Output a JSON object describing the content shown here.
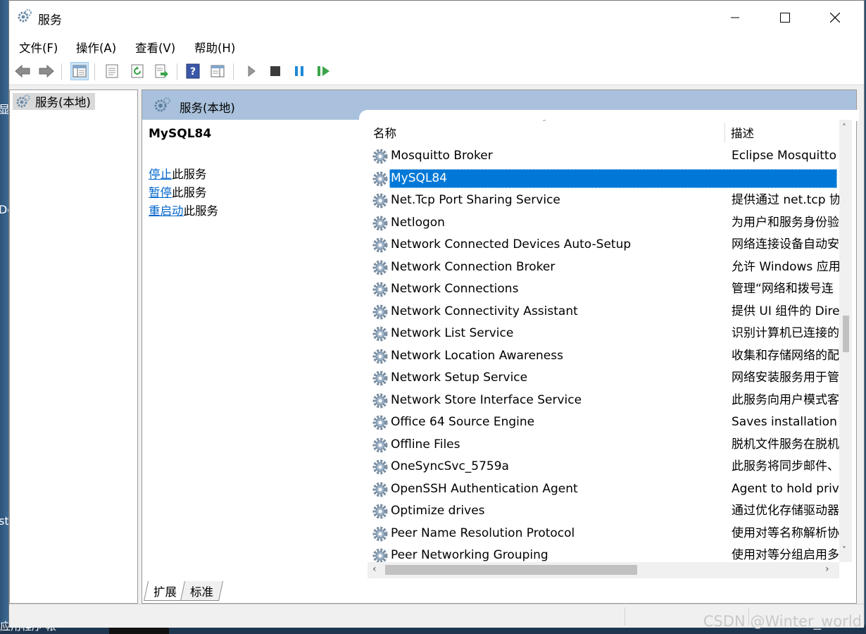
{
  "window": {
    "title": "服务"
  },
  "menu": [
    "文件(F)",
    "操作(A)",
    "查看(V)",
    "帮助(H)"
  ],
  "toolbar_icons": [
    "back-arrow-icon",
    "forward-arrow-icon",
    "show-hide-console-tree-icon",
    "properties-icon",
    "refresh-icon",
    "export-list-icon",
    "help-icon",
    "action-pane-icon",
    "start-service-icon",
    "stop-service-icon",
    "pause-service-icon",
    "restart-service-icon"
  ],
  "tree": {
    "root_label": "服务(本地)"
  },
  "header": {
    "title": "服务(本地)"
  },
  "extended": {
    "service_name": "MySQL84",
    "actions": [
      {
        "link": "停止",
        "suffix": "此服务"
      },
      {
        "link": "暂停",
        "suffix": "此服务"
      },
      {
        "link": "重启动",
        "suffix": "此服务"
      }
    ]
  },
  "columns": {
    "name": "名称",
    "description": "描述"
  },
  "services": [
    {
      "name": "Mosquitto Broker",
      "description": "Eclipse Mosquitto M"
    },
    {
      "name": "MySQL84",
      "description": "",
      "selected": true
    },
    {
      "name": "Net.Tcp Port Sharing Service",
      "description": "提供通过 net.tcp 协"
    },
    {
      "name": "Netlogon",
      "description": "为用户和服务身份验"
    },
    {
      "name": "Network Connected Devices Auto-Setup",
      "description": "网络连接设备自动安"
    },
    {
      "name": "Network Connection Broker",
      "description": "允许 Windows 应用"
    },
    {
      "name": "Network Connections",
      "description": "管理“网络和拨号连"
    },
    {
      "name": "Network Connectivity Assistant",
      "description": "提供 UI 组件的 Dire"
    },
    {
      "name": "Network List Service",
      "description": "识别计算机已连接的"
    },
    {
      "name": "Network Location Awareness",
      "description": "收集和存储网络的配"
    },
    {
      "name": "Network Setup Service",
      "description": "网络安装服务用于管"
    },
    {
      "name": "Network Store Interface Service",
      "description": "此服务向用户模式客"
    },
    {
      "name": "Office 64 Source Engine",
      "description": "Saves installation fi"
    },
    {
      "name": "Offline Files",
      "description": "脱机文件服务在脱机"
    },
    {
      "name": "OneSyncSvc_5759a",
      "description": "此服务将同步邮件、"
    },
    {
      "name": "OpenSSH Authentication Agent",
      "description": "Agent to hold priva"
    },
    {
      "name": "Optimize drives",
      "description": "通过优化存储驱动器"
    },
    {
      "name": "Peer Name Resolution Protocol",
      "description": "使用对等名称解析协"
    },
    {
      "name": "Peer Networking Grouping",
      "description": "使用对等分组启用多"
    }
  ],
  "tabs": [
    "扩展",
    "标准"
  ],
  "desktop_fragments": [
    "显",
    "De",
    "st",
    "应用程序 帐"
  ],
  "watermark": "CSDN @Winter_world",
  "colors": {
    "selection": "#0078d7",
    "header_band": "#a9c1dc",
    "link": "#0066cc"
  }
}
